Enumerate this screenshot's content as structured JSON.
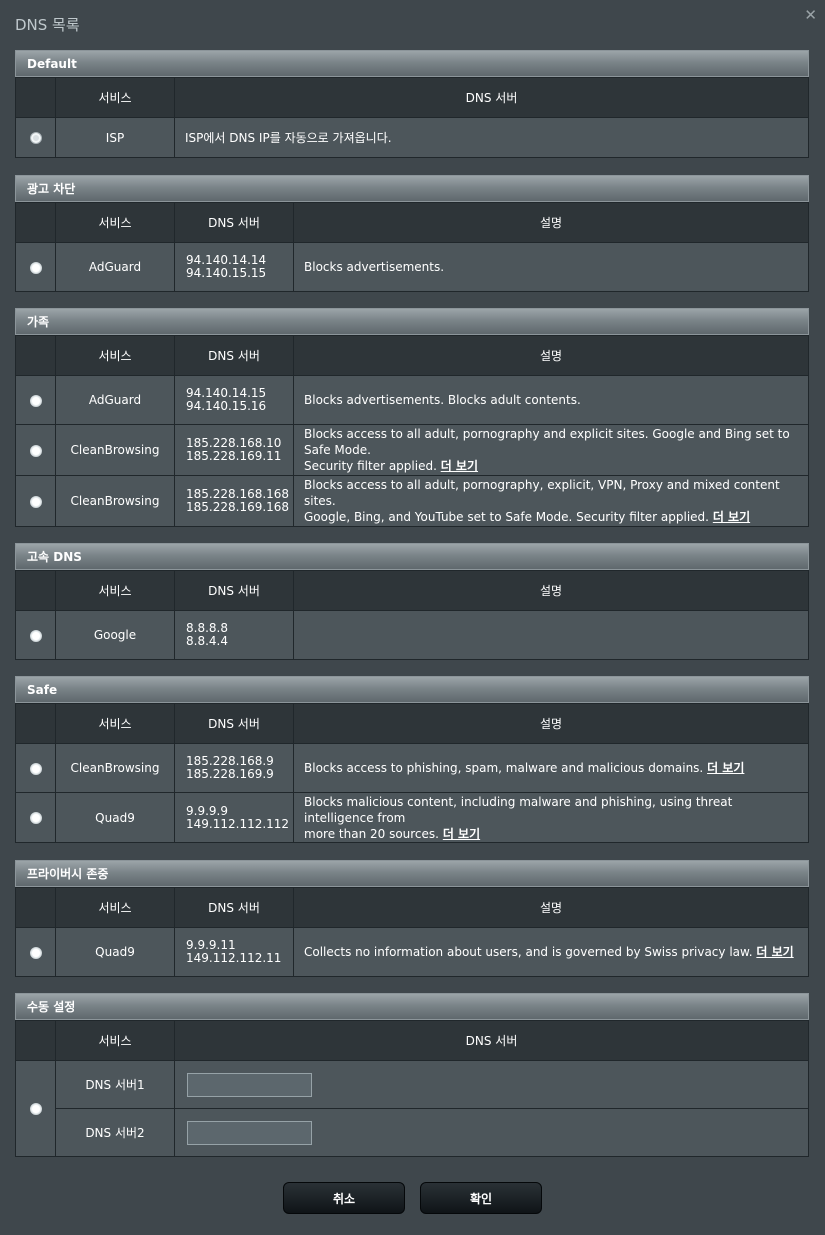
{
  "dialog": {
    "title": "DNS 목록",
    "close_label": "✕"
  },
  "headers": {
    "service": "서비스",
    "dns_server": "DNS 서버",
    "description": "설명"
  },
  "sections": {
    "default": {
      "title": "Default",
      "rows": [
        {
          "service": "ISP",
          "desc": "ISP에서 DNS IP를 자동으로 가져옵니다."
        }
      ]
    },
    "adblock": {
      "title": "광고 차단",
      "rows": [
        {
          "service": "AdGuard",
          "dns1": "94.140.14.14",
          "dns2": "94.140.15.15",
          "desc": "Blocks advertisements."
        }
      ]
    },
    "family": {
      "title": "가족",
      "rows": [
        {
          "service": "AdGuard",
          "dns1": "94.140.14.15",
          "dns2": "94.140.15.16",
          "desc": "Blocks advertisements. Blocks adult contents."
        },
        {
          "service": "CleanBrowsing",
          "dns1": "185.228.168.10",
          "dns2": "185.228.169.11",
          "desc_line1": "Blocks access to all adult, pornography and explicit sites. Google and Bing set to Safe Mode.",
          "desc_line2": "Security filter applied."
        },
        {
          "service": "CleanBrowsing",
          "dns1": "185.228.168.168",
          "dns2": "185.228.169.168",
          "desc_line1": "Blocks access to all adult, pornography, explicit, VPN, Proxy and mixed content sites.",
          "desc_line2": "Google, Bing, and YouTube set to Safe Mode. Security filter applied."
        }
      ]
    },
    "fast": {
      "title": "고속 DNS",
      "rows": [
        {
          "service": "Google",
          "dns1": "8.8.8.8",
          "dns2": "8.8.4.4",
          "desc": ""
        }
      ]
    },
    "safe": {
      "title": "Safe",
      "rows": [
        {
          "service": "CleanBrowsing",
          "dns1": "185.228.168.9",
          "dns2": "185.228.169.9",
          "desc": "Blocks access to phishing, spam, malware and malicious domains."
        },
        {
          "service": "Quad9",
          "dns1": "9.9.9.9",
          "dns2": "149.112.112.112",
          "desc_line1": "Blocks malicious content, including malware and phishing, using threat intelligence from",
          "desc_line2": "more than 20 sources."
        }
      ]
    },
    "privacy": {
      "title": "프라이버시 존중",
      "rows": [
        {
          "service": "Quad9",
          "dns1": "9.9.9.11",
          "dns2": "149.112.112.11",
          "desc": "Collects no information about users, and is governed by Swiss privacy law."
        }
      ]
    },
    "manual": {
      "title": "수동 설정",
      "rows": [
        {
          "service": "DNS 서버1",
          "value": ""
        },
        {
          "service": "DNS 서버2",
          "value": ""
        }
      ]
    }
  },
  "more_label": "더 보기",
  "buttons": {
    "cancel": "취소",
    "ok": "확인"
  }
}
